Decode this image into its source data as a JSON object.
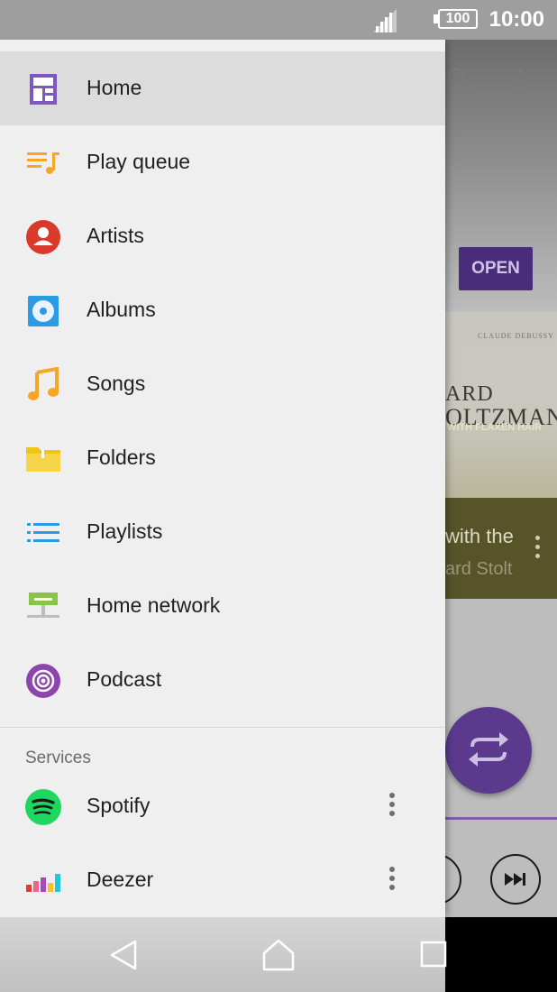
{
  "status_bar": {
    "battery": "100",
    "time": "10:00"
  },
  "drawer": {
    "items": [
      {
        "label": "Home",
        "icon": "home-grid-icon",
        "selected": true
      },
      {
        "label": "Play queue",
        "icon": "play-queue-icon",
        "selected": false
      },
      {
        "label": "Artists",
        "icon": "artist-icon",
        "selected": false
      },
      {
        "label": "Albums",
        "icon": "album-icon",
        "selected": false
      },
      {
        "label": "Songs",
        "icon": "music-note-icon",
        "selected": false
      },
      {
        "label": "Folders",
        "icon": "folder-icon",
        "selected": false
      },
      {
        "label": "Playlists",
        "icon": "playlist-icon",
        "selected": false
      },
      {
        "label": "Home network",
        "icon": "home-network-icon",
        "selected": false
      },
      {
        "label": "Podcast",
        "icon": "podcast-icon",
        "selected": false
      }
    ],
    "services_header": "Services",
    "services": [
      {
        "label": "Spotify",
        "icon": "spotify-icon"
      },
      {
        "label": "Deezer",
        "icon": "deezer-icon"
      }
    ]
  },
  "background_app": {
    "open_button": "OPEN",
    "album_art_composer": "CLAUDE DEBUSSY",
    "album_art_line1": "ARD",
    "album_art_line2": "OLTZMAN",
    "album_art_line3": "WITH FLAXEN HAIR",
    "now_playing_title": "with the",
    "now_playing_artist": "ard Stolt"
  },
  "colors": {
    "status_bar": "#9e9e9e",
    "drawer_bg": "#efefef",
    "selected_bg": "#dcdcdc",
    "accent_purple": "#5b3a8e"
  }
}
